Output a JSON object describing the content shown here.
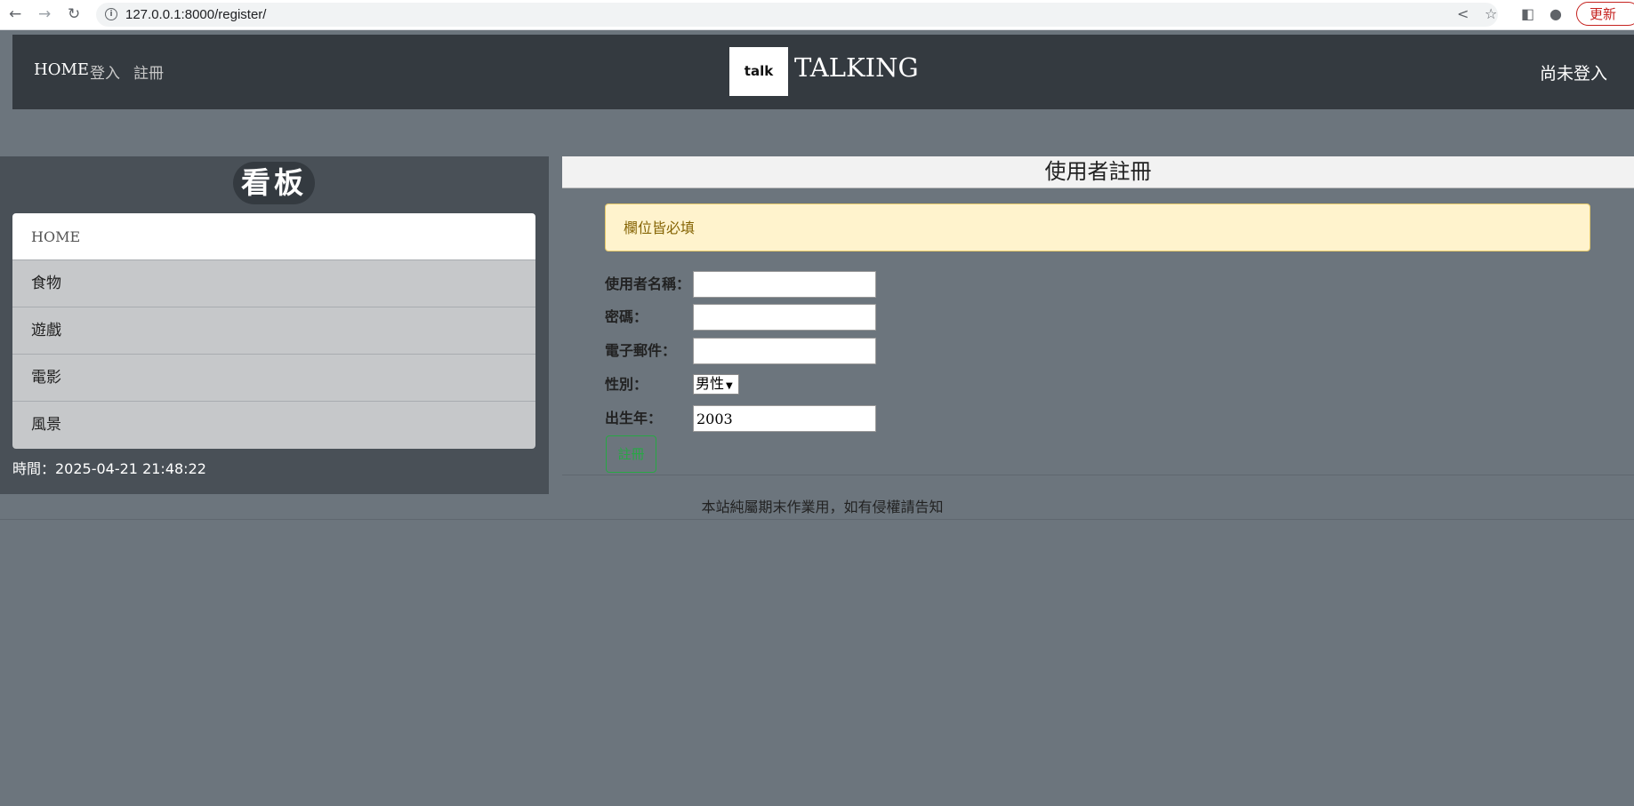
{
  "browser": {
    "url": "127.0.0.1:8000/register/",
    "update_label": "更新"
  },
  "header": {
    "nav": [
      "HOME",
      "登入",
      "註冊"
    ],
    "logo_text": "talk",
    "brand": "TALKING",
    "login_status": "尚未登入"
  },
  "sidebar": {
    "title": "看板",
    "items": [
      "HOME",
      "食物",
      "遊戲",
      "電影",
      "風景"
    ],
    "active_index": 0,
    "clock": "時間：2025-04-21 21:48:22"
  },
  "form": {
    "title": "使用者註冊",
    "alert": "欄位皆必填",
    "username_label": "使用者名稱：",
    "username_value": "",
    "password_label": "密碼：",
    "password_value": "",
    "email_label": "電子郵件：",
    "email_value": "",
    "gender_label": "性別：",
    "gender_value": "男性",
    "birth_label": "出生年：",
    "birth_value": "2003",
    "submit_label": "註冊"
  },
  "footer": {
    "text": "本站純屬期末作業用，如有侵權請告知"
  },
  "colors": {
    "page_bg": "#6c757d",
    "header_bg": "#343a40",
    "sidebar_bg": "#495057",
    "alert_bg": "#fff3cd",
    "submit_green": "#28a745"
  }
}
